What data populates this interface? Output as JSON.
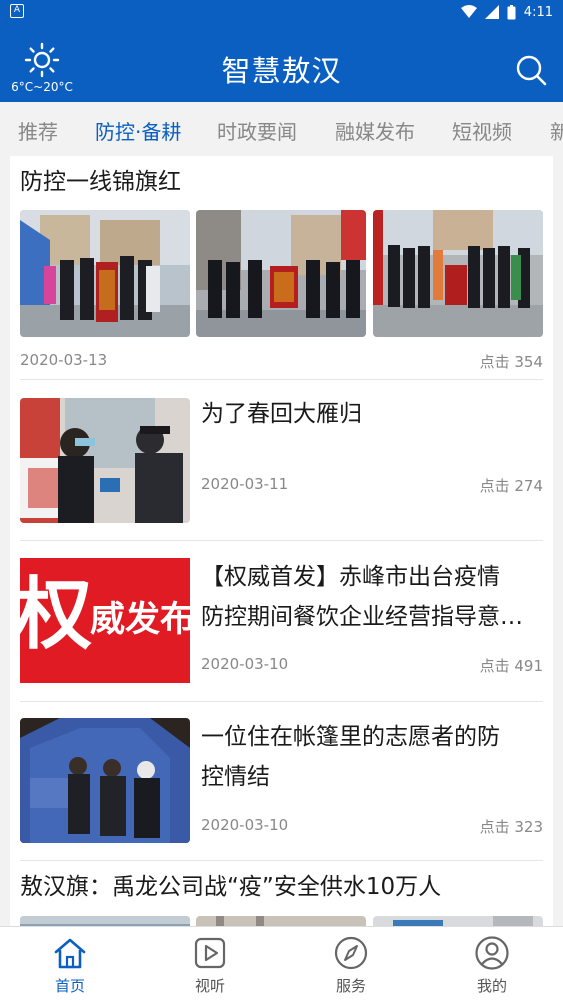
{
  "status_bar": {
    "time": "4:11",
    "left_icon": "A"
  },
  "header": {
    "weather_icon": "sun-icon",
    "temperature": "6°C~20°C",
    "title": "智慧敖汉",
    "search_icon": "search-icon"
  },
  "tabs": [
    {
      "label": "推荐",
      "active": false
    },
    {
      "label": "防控·备耕",
      "active": true
    },
    {
      "label": "时政要闻",
      "active": false
    },
    {
      "label": "融媒发布",
      "active": false
    },
    {
      "label": "短视频",
      "active": false
    },
    {
      "label": "新",
      "active": false
    }
  ],
  "articles": [
    {
      "title": "防控一线锦旗红",
      "date": "2020-03-13",
      "clicks": "点击 354"
    },
    {
      "title": "为了春回大雁归",
      "date": "2020-03-11",
      "clicks": "点击 274"
    },
    {
      "title_line1": "【权威首发】赤峰市出台疫情",
      "title_line2": "防控期间餐饮企业经营指导意…",
      "date": "2020-03-10",
      "clicks": "点击 491",
      "thumb_text_big": "权",
      "thumb_text_small": "威发布"
    },
    {
      "title_line1": "一位住在帐篷里的志愿者的防",
      "title_line2": "控情结",
      "date": "2020-03-10",
      "clicks": "点击 323"
    },
    {
      "title": "敖汉旗：禹龙公司战“疫”安全供水10万人"
    }
  ],
  "bottom_nav": [
    {
      "label": "首页",
      "icon": "home-icon",
      "active": true
    },
    {
      "label": "视听",
      "icon": "play-icon",
      "active": false
    },
    {
      "label": "服务",
      "icon": "compass-icon",
      "active": false
    },
    {
      "label": "我的",
      "icon": "user-icon",
      "active": false
    }
  ],
  "colors": {
    "brand_blue": "#0b5fc0",
    "tab_bg": "#f2f2f2",
    "red_banner": "#e01b24"
  }
}
